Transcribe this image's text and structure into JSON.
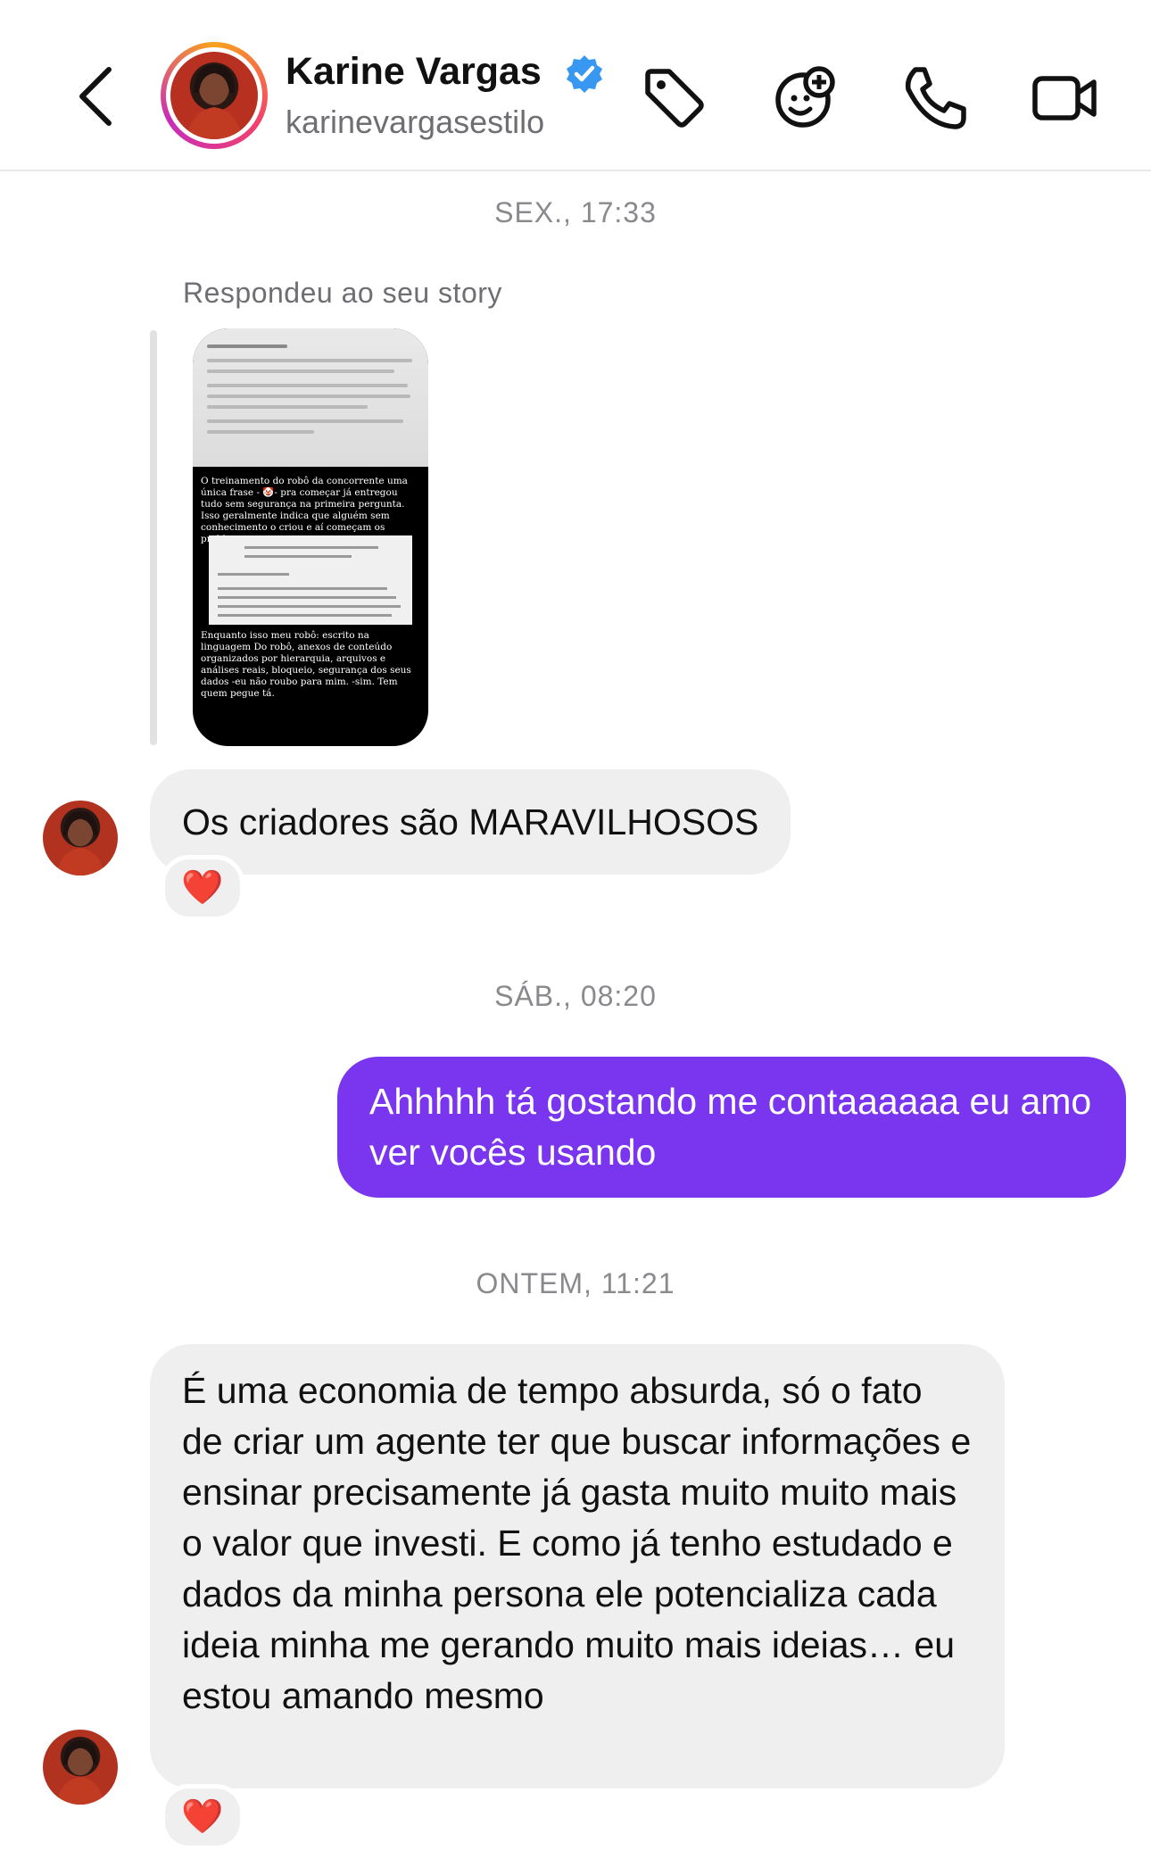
{
  "header": {
    "contact_name": "Karine Vargas",
    "username": "karinevargasestilo",
    "verified": true,
    "accent_verified": "#3897f0",
    "icons": [
      "back-chevron-icon",
      "tag-icon",
      "sticker-icon",
      "phone-icon",
      "video-camera-icon"
    ]
  },
  "messages": {
    "ts1": "SEX., 17:33",
    "reply_label": "Respondeu ao seu story",
    "story": {
      "text1": "O treinamento do robô da concorrente uma única frase - 🤡- pra começar já entregou tudo sem segurança na primeira pergunta. Isso geralmente indica que alguém sem conhecimento o criou e aí começam os problemas",
      "text2": "Enquanto isso meu robô: escrito na linguagem Do robô, anexos de conteúdo organizados por hierarquia, arquivos e análises reais, bloqueio, segurança dos seus dados -eu não roubo para mim. -sim. Tem quem pegue tá."
    },
    "msg1": "Os criadores são MARAVILHOSOS",
    "msg1_reaction": "❤️",
    "ts2": "SÁB., 08:20",
    "msg2": "Ahhhhh tá gostando me contaaaaaa eu amo ver vocês usando",
    "ts3": "ONTEM, 11:21",
    "msg3": "É uma economia de tempo absurda, só o fato de criar um agente ter que buscar informações e ensinar precisamente já gasta muito muito mais o valor que investi. E como já tenho estudado e dados da minha persona ele potencializa cada ideia minha me gerando muito mais ideias… eu estou amando mesmo",
    "msg3_reaction": "❤️"
  },
  "colors": {
    "outgoing_bubble": "#7a36ee",
    "incoming_bubble": "#efefef",
    "timestamp": "#8a8a8e"
  }
}
